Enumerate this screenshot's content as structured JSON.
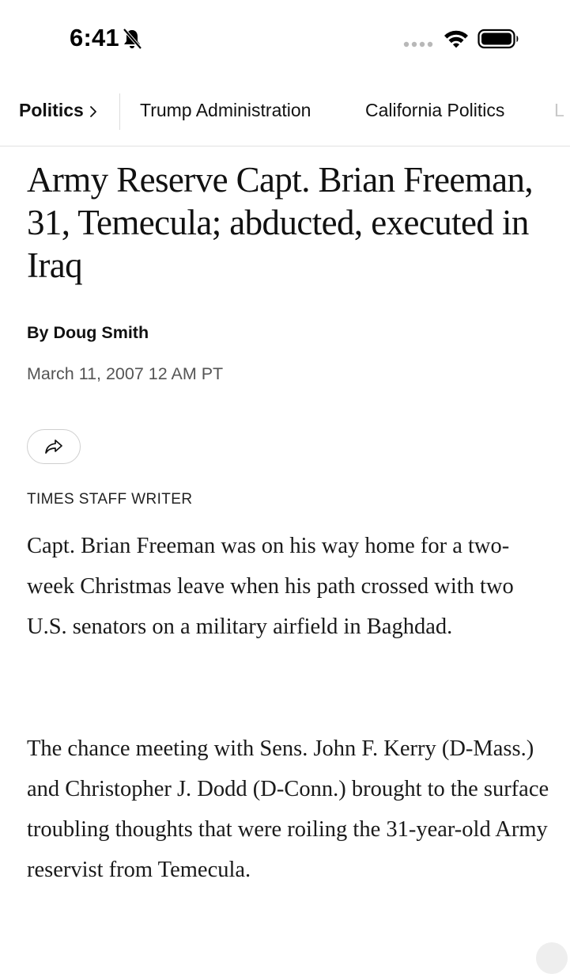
{
  "status_bar": {
    "time": "6:41",
    "icons": [
      "bell-slash-icon",
      "signal-icon",
      "wifi-icon",
      "battery-icon"
    ]
  },
  "section_nav": {
    "primary": "Politics",
    "items": [
      "Trump Administration",
      "California Politics",
      "L"
    ]
  },
  "article": {
    "headline": "Army Reserve Capt. Brian Freeman, 31, Temecula; abducted, executed in Iraq",
    "byline": "By Doug Smith",
    "date": "March 11, 2007 12 AM PT",
    "share_icon": "share-arrow-icon",
    "staff_label": "TIMES STAFF WRITER",
    "paragraphs": [
      "Capt. Brian Freeman was on his way home for a two-week Christmas leave when his path crossed with two U.S. senators on a military airfield in Baghdad.",
      "The chance meeting with Sens. John F. Kerry (D-Mass.) and Christopher J. Dodd (D-Conn.) brought to the surface troubling thoughts that were roiling the 31-year-old Army reservist from Temecula."
    ]
  },
  "colors": {
    "text": "#111111",
    "muted": "#555555",
    "divider": "#e1e1e1"
  }
}
